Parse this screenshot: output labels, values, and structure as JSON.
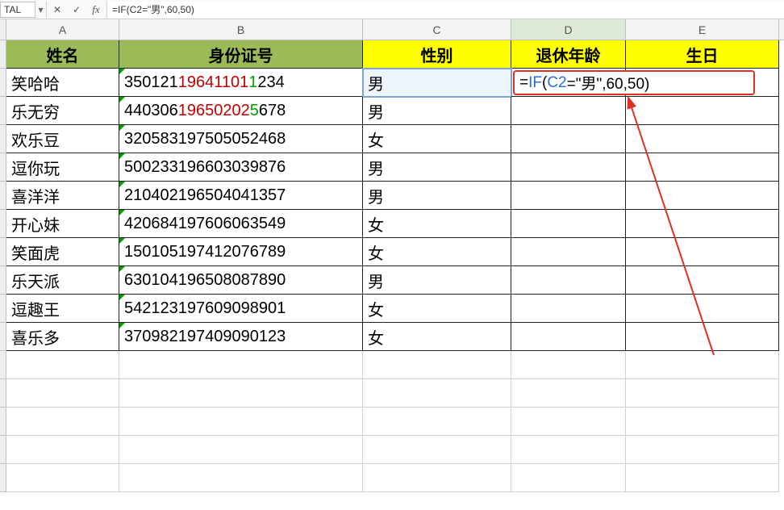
{
  "formula_bar": {
    "name_box": "TAL",
    "formula_text": "=IF(C2=\"男\",60,50)",
    "fx_label": "fx",
    "cancel_glyph": "✕",
    "accept_glyph": "✓",
    "dd_glyph": "▾"
  },
  "columns": [
    "A",
    "B",
    "C",
    "D",
    "E"
  ],
  "selected_col": "D",
  "header": {
    "A": "姓名",
    "B": "身份证号",
    "C": "性别",
    "D": "退休年龄",
    "E": "生日"
  },
  "rows": [
    {
      "name": "笑哈哈",
      "id": {
        "a": "350121",
        "b": "19641101",
        "c": "1",
        "d": "234"
      },
      "sex": "男",
      "d": "=IF(C2=\"男\",60,50)",
      "e": ""
    },
    {
      "name": "乐无穷",
      "id": {
        "a": "440306",
        "b": "19650202",
        "c": "5",
        "d": "678"
      },
      "sex": "男",
      "d": "",
      "e": ""
    },
    {
      "name": "欢乐豆",
      "id": {
        "a": "320583197505052468"
      },
      "sex": "女",
      "d": "",
      "e": ""
    },
    {
      "name": "逗你玩",
      "id": {
        "a": "500233196603039876"
      },
      "sex": "男",
      "d": "",
      "e": ""
    },
    {
      "name": "喜洋洋",
      "id": {
        "a": "210402196504041357"
      },
      "sex": "男",
      "d": "",
      "e": ""
    },
    {
      "name": "开心妹",
      "id": {
        "a": "420684197606063549"
      },
      "sex": "女",
      "d": "",
      "e": ""
    },
    {
      "name": "笑面虎",
      "id": {
        "a": "150105197412076789"
      },
      "sex": "女",
      "d": "",
      "e": ""
    },
    {
      "name": "乐天派",
      "id": {
        "a": "630104196508087890"
      },
      "sex": "男",
      "d": "",
      "e": ""
    },
    {
      "name": "逗趣王",
      "id": {
        "a": "542123197609098901"
      },
      "sex": "女",
      "d": "",
      "e": ""
    },
    {
      "name": "喜乐多",
      "id": {
        "a": "370982197409090123"
      },
      "sex": "女",
      "d": "",
      "e": ""
    }
  ],
  "d2_display": {
    "eq": "=",
    "fn": "IF",
    "op": "(",
    "ref": "C2",
    "rest": "=\"男\",60,50)"
  },
  "colors": {
    "hdr_green": "#9bbb59",
    "hdr_yellow": "#ffff00",
    "callout_red": "#e03020",
    "ref_blue": "#2a6dd6"
  }
}
